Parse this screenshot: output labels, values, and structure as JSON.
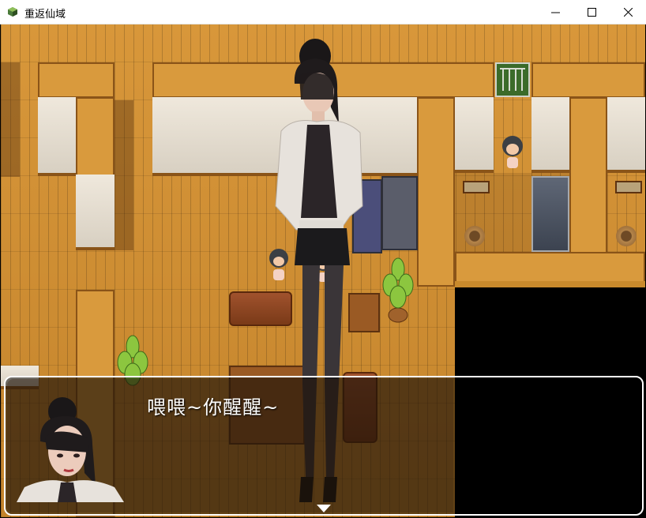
{
  "window": {
    "title": "重返仙域",
    "icon": "app-game-icon",
    "controls": [
      "minimize-icon",
      "maximize-icon",
      "close-icon"
    ]
  },
  "scene": {
    "floor_color": "#c98a2c",
    "npcs": [
      "npc-child-top",
      "npc-child-left",
      "npc-child-right"
    ],
    "objects": [
      "sofa",
      "coffee-table",
      "bookshelf",
      "plant",
      "cage",
      "bed",
      "basket"
    ]
  },
  "dialog": {
    "text": "喂喂~你醒醒~",
    "speaker_face": "woman-portrait",
    "continue_icon": "down-arrow-icon"
  }
}
